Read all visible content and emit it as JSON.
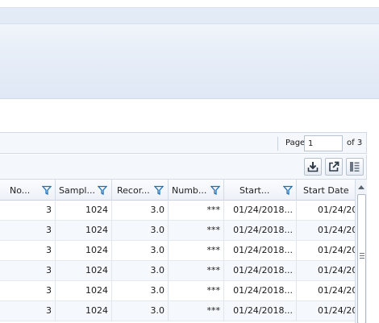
{
  "pager": {
    "page_label": "Page",
    "page_value": "1",
    "page_of": "of 3"
  },
  "toolbar": {
    "export_icon": "download-icon",
    "open_icon": "external-link-icon",
    "columns_icon": "column-chooser-icon"
  },
  "grid": {
    "columns": [
      {
        "label": "No...",
        "filter": true
      },
      {
        "label": "Sampl...",
        "filter": true
      },
      {
        "label": "Recor...",
        "filter": true
      },
      {
        "label": "Numb...",
        "filter": true
      },
      {
        "label": "Start...",
        "filter": true
      },
      {
        "label": "Start Date",
        "filter": false
      }
    ],
    "rows": [
      [
        "3",
        "1024",
        "3.0",
        "***",
        "01/24/2018...",
        "01/24/20"
      ],
      [
        "3",
        "1024",
        "3.0",
        "***",
        "01/24/2018...",
        "01/24/20"
      ],
      [
        "3",
        "1024",
        "3.0",
        "***",
        "01/24/2018...",
        "01/24/20"
      ],
      [
        "3",
        "1024",
        "3.0",
        "***",
        "01/24/2018...",
        "01/24/20"
      ],
      [
        "3",
        "1024",
        "3.0",
        "***",
        "01/24/2018...",
        "01/24/20"
      ],
      [
        "3",
        "1024",
        "3.0",
        "***",
        "01/24/2018...",
        "01/24/20"
      ]
    ]
  },
  "colors": {
    "filter_icon": "#1f6fb8",
    "header_bg": "#edf1f7",
    "accent": "#2a6ebd"
  }
}
